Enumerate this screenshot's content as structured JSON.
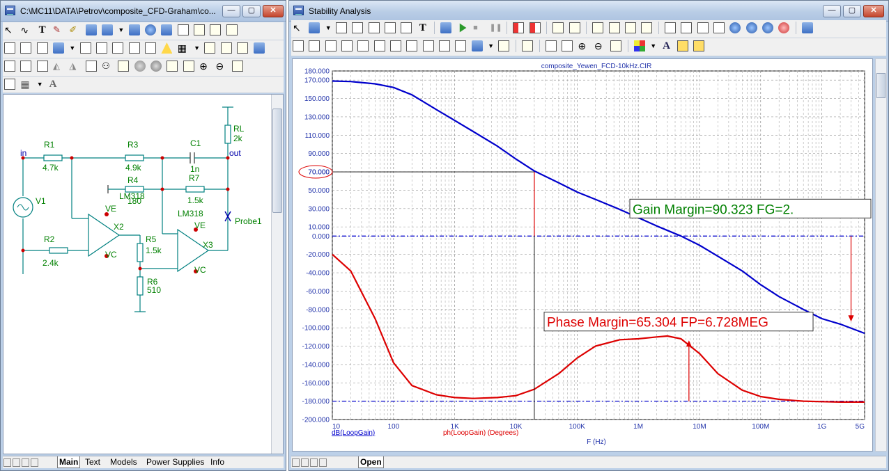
{
  "left_window": {
    "title": "C:\\MC11\\DATA\\Petrov\\composite_CFD-Graham\\co...",
    "tabs": [
      "Main",
      "Text",
      "Models",
      "Power Supplies",
      "Info"
    ],
    "active_tab": "Main"
  },
  "schematic": {
    "nodes": {
      "in": "in",
      "out": "out"
    },
    "components": [
      {
        "ref": "R1",
        "value": "4.7k"
      },
      {
        "ref": "R3",
        "value": "4.9k"
      },
      {
        "ref": "C1",
        "value": "1n"
      },
      {
        "ref": "RL",
        "value": "2k"
      },
      {
        "ref": "R4",
        "value": "180"
      },
      {
        "ref": "R7",
        "value": "1.5k"
      },
      {
        "ref": "V1",
        "value": ""
      },
      {
        "ref": "R2",
        "value": "2.4k"
      },
      {
        "ref": "R5",
        "value": "1.5k"
      },
      {
        "ref": "R6",
        "value": "510"
      },
      {
        "ref": "X2",
        "value": "LM318"
      },
      {
        "ref": "X3",
        "value": "LM318"
      },
      {
        "ref": "Probe1",
        "value": ""
      }
    ],
    "pins": {
      "ve": "VE",
      "vc": "VC"
    }
  },
  "right_window": {
    "title": "Stability Analysis",
    "tabs": [
      "Open"
    ],
    "active_tab": "Open"
  },
  "chart_data": {
    "type": "line",
    "title": "composite_Yewen_FCD-10kHz.CIR",
    "xlabel": "F (Hz)",
    "x_scale": "log",
    "xlim": [
      10,
      5000000000
    ],
    "x_ticks": [
      10,
      100,
      1000,
      10000,
      100000,
      1000000,
      10000000,
      100000000,
      1000000000,
      5000000000
    ],
    "x_tick_labels": [
      "10",
      "100",
      "1K",
      "10K",
      "100K",
      "1M",
      "10M",
      "100M",
      "1G",
      "5G"
    ],
    "ylim": [
      -200,
      180
    ],
    "y_ticks": [
      180,
      170,
      150,
      130,
      110,
      90,
      70,
      50,
      30,
      10,
      0,
      -20,
      -40,
      -60,
      -80,
      -100,
      -120,
      -140,
      -160,
      -180,
      -200
    ],
    "y_tick_labels": [
      "180.000",
      "170.000",
      "150.000",
      "130.000",
      "110.000",
      "90.000",
      "70.000",
      "50.000",
      "30.000",
      "10.000",
      "0.000",
      "-20.000",
      "-40.000",
      "-60.000",
      "-80.000",
      "-100.000",
      "-120.000",
      "-140.000",
      "-160.000",
      "-180.000",
      "-200.000"
    ],
    "grid": true,
    "series": [
      {
        "name": "dB(LoopGain)",
        "color": "#0000cc",
        "x": [
          10,
          20,
          50,
          100,
          200,
          500,
          1000,
          2000,
          5000,
          10000,
          20000,
          50000,
          100000,
          200000,
          500000,
          1000000,
          2000000,
          5000000,
          10000000,
          20000000,
          50000000,
          100000000,
          200000000,
          500000000,
          1000000000,
          2000000000,
          5000000000
        ],
        "y": [
          169,
          168.5,
          166,
          162,
          154,
          138,
          126,
          114,
          98,
          84,
          71,
          58,
          48,
          40,
          29,
          20,
          11,
          0,
          -10,
          -22,
          -38,
          -53,
          -66,
          -80,
          -90,
          -96,
          -106
        ]
      },
      {
        "name": "ph(LoopGain) (Degrees)",
        "color": "#dd0000",
        "x": [
          10,
          20,
          50,
          100,
          200,
          500,
          1000,
          2000,
          5000,
          10000,
          20000,
          50000,
          100000,
          200000,
          500000,
          1000000,
          2000000,
          3000000,
          5000000,
          10000000,
          20000000,
          50000000,
          100000000,
          200000000,
          500000000,
          1000000000,
          2000000000,
          5000000000
        ],
        "y": [
          -20,
          -38,
          -90,
          -138,
          -163,
          -173,
          -176,
          -177,
          -176,
          -174,
          -167,
          -150,
          -133,
          -120,
          -113,
          -112,
          -110,
          -109,
          -112,
          -128,
          -150,
          -168,
          -175,
          -178,
          -180,
          -180.5,
          -181,
          -181
        ]
      }
    ],
    "reference_lines": [
      {
        "axis": "y",
        "value": 0,
        "color": "#0000cc",
        "style": "dashed"
      },
      {
        "axis": "y",
        "value": -180,
        "color": "#0000cc",
        "style": "dashed"
      }
    ],
    "cursor": {
      "x": 20000,
      "y": 70,
      "marker_label": "70.000"
    },
    "annotations": [
      {
        "text": "Gain Margin=90.323 FG=2.",
        "color": "#008000",
        "x": 3000000000,
        "y": -94
      },
      {
        "text": "Phase Margin=65.304 FP=6.728MEG",
        "color": "#dd0000",
        "x": 6728000,
        "y": -180
      }
    ],
    "legend": "bottom-left"
  }
}
